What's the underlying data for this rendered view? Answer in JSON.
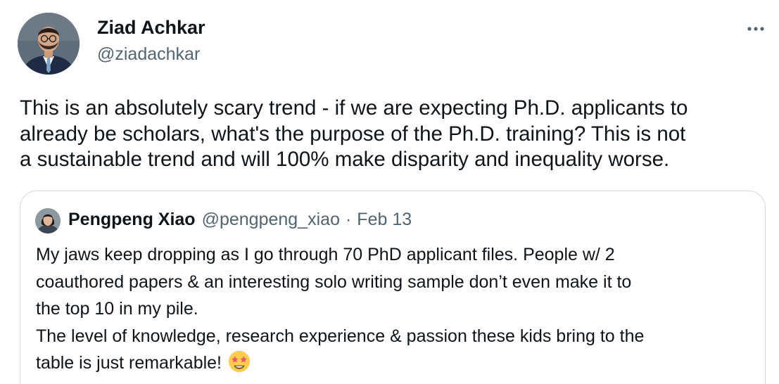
{
  "author": {
    "name": "Ziad Achkar",
    "handle": "@ziadachkar"
  },
  "more_icon": "more-horizontal-icon",
  "tweet": {
    "lines": [
      "This is an absolutely scary trend - if we are expecting Ph.D. applicants to",
      "already be scholars, what's the purpose of the Ph.D. training? This is not",
      "a sustainable trend and will 100% make disparity and inequality worse."
    ]
  },
  "quoted": {
    "name": "Pengpeng Xiao",
    "handle": "@pengpeng_xiao",
    "separator": "·",
    "date": "Feb 13",
    "lines": [
      "My jaws keep dropping as I go through 70 PhD applicant files. People w/ 2",
      "coauthored papers & an interesting solo writing sample don’t even make it to",
      "the top 10 in my pile.",
      "The level of knowledge, research experience & passion these kids bring to the",
      "table is just remarkable!"
    ],
    "emoji": "star-struck-emoji"
  },
  "colors": {
    "text_primary": "#0f1419",
    "text_secondary": "#536471",
    "border": "#cfd9de",
    "background": "#ffffff"
  }
}
